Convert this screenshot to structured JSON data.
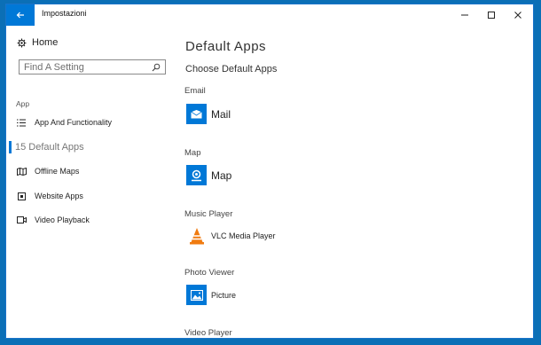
{
  "window": {
    "title": "Impostazioni"
  },
  "sidebar": {
    "home_label": "Home",
    "search_placeholder": "Find A Setting",
    "section_label": "App",
    "items": [
      {
        "label": "App And Functionality",
        "icon": "list-icon"
      },
      {
        "label": "15 Default Apps",
        "icon": "",
        "selected": true
      },
      {
        "label": "Offline Maps",
        "icon": "map-icon"
      },
      {
        "label": "Website Apps",
        "icon": "web-icon"
      },
      {
        "label": "Video Playback",
        "icon": "video-icon"
      }
    ]
  },
  "main": {
    "title": "Default Apps",
    "subtitle": "Choose Default Apps",
    "categories": [
      {
        "label": "Email",
        "app": "Mail",
        "icon": "mail-icon"
      },
      {
        "label": "Map",
        "app": "Map",
        "icon": "maps-app-icon"
      },
      {
        "label": "Music Player",
        "app": "VLC Media Player",
        "icon": "vlc-icon"
      },
      {
        "label": "Photo Viewer",
        "app": "Picture",
        "icon": "photos-icon"
      },
      {
        "label": "Video Player",
        "app": "",
        "icon": ""
      }
    ]
  },
  "colors": {
    "accent": "#0078d7",
    "desktop": "#0b6fb6",
    "vlc_orange": "#f07b10"
  }
}
